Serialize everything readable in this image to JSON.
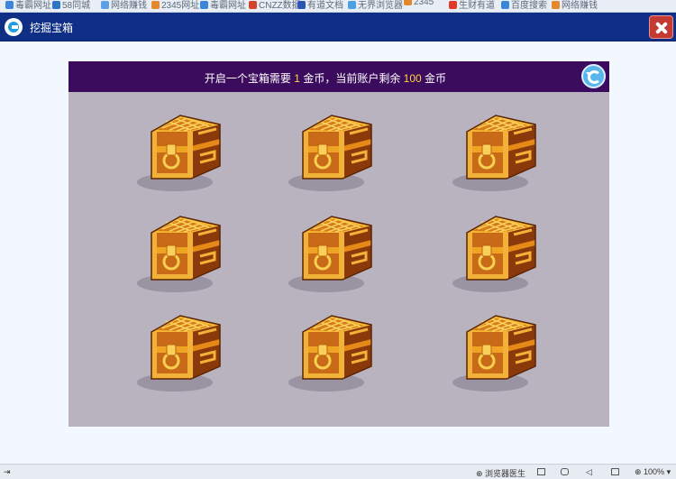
{
  "favbar": {
    "items": [
      "毒霸网址",
      "58同城",
      "网络赚钱",
      "2345网址",
      "毒霸网址",
      "CNZZ数据",
      "有道文档",
      "无界浏览器",
      "2345",
      "生财有道",
      "百度搜索",
      "网络赚钱"
    ]
  },
  "dialog": {
    "title": "挖掘宝箱",
    "app_icon": "app-logo-icon",
    "close_icon": "close-icon"
  },
  "game": {
    "info_prefix": "开启一个宝箱需要",
    "cost": "1",
    "info_mid": "金币，当前账户剩余",
    "balance": "100",
    "info_suffix": "金币",
    "refresh_icon": "refresh-icon",
    "chests": [
      "treasure-chest-icon",
      "treasure-chest-icon",
      "treasure-chest-icon",
      "treasure-chest-icon",
      "treasure-chest-icon",
      "treasure-chest-icon",
      "treasure-chest-icon",
      "treasure-chest-icon",
      "treasure-chest-icon"
    ]
  },
  "statusbar": {
    "assistant_label": "浏览器医生",
    "zoom": "100%"
  },
  "colors": {
    "titlebar": "#0f2f86",
    "panel_header": "#3b0b5e",
    "panel_bg": "#b9b3bf",
    "highlight": "#ffd83a",
    "close_button": "#c43a33"
  }
}
